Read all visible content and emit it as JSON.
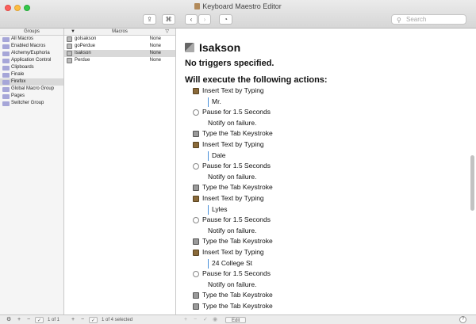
{
  "window": {
    "title": "Keyboard Maestro Editor"
  },
  "toolbar": {
    "share_icon": "⇪",
    "command_icon": "⌘",
    "back_icon": "‹",
    "forward_icon": "›",
    "history_icon": "◔",
    "search_placeholder": "Search"
  },
  "groups": {
    "header": "Groups",
    "items": [
      "All Macros",
      "Enabled Macros",
      "Alchemy/Euphoria",
      "Application Control",
      "Clipboards",
      "Finale",
      "Firefox",
      "Global Macro Group",
      "Pages",
      "Switcher Group"
    ],
    "selected_index": 6
  },
  "macros": {
    "header": "Macros",
    "items": [
      {
        "name": "goIsakson",
        "trigger": "None"
      },
      {
        "name": "goPerdue",
        "trigger": "None"
      },
      {
        "name": "Isakson",
        "trigger": "None"
      },
      {
        "name": "Perdue",
        "trigger": "None"
      }
    ],
    "selected_index": 2
  },
  "detail": {
    "title": "Isakson",
    "triggers": "No triggers specified.",
    "execute": "Will execute the following actions:",
    "actions": [
      {
        "type": "insert",
        "label": "Insert Text by Typing",
        "text": "Mr."
      },
      {
        "type": "pause",
        "label": "Pause for 1.5 Seconds",
        "note": "Notify on failure."
      },
      {
        "type": "key",
        "label": "Type the Tab Keystroke"
      },
      {
        "type": "insert",
        "label": "Insert Text by Typing",
        "text": "Dale"
      },
      {
        "type": "pause",
        "label": "Pause for 1.5 Seconds",
        "note": "Notify on failure."
      },
      {
        "type": "key",
        "label": "Type the Tab Keystroke"
      },
      {
        "type": "insert",
        "label": "Insert Text by Typing",
        "text": "Lyles"
      },
      {
        "type": "pause",
        "label": "Pause for 1.5 Seconds",
        "note": "Notify on failure."
      },
      {
        "type": "key",
        "label": "Type the Tab Keystroke"
      },
      {
        "type": "insert",
        "label": "Insert Text by Typing",
        "text": "24 College St"
      },
      {
        "type": "pause",
        "label": "Pause for 1.5 Seconds",
        "note": "Notify on failure."
      },
      {
        "type": "key",
        "label": "Type the Tab Keystroke"
      },
      {
        "type": "key",
        "label": "Type the Tab Keystroke"
      }
    ]
  },
  "bottom": {
    "groups_count": "1 of 1",
    "macros_count": "1 of 4 selected",
    "edit_label": "Edit",
    "help_label": "?"
  }
}
